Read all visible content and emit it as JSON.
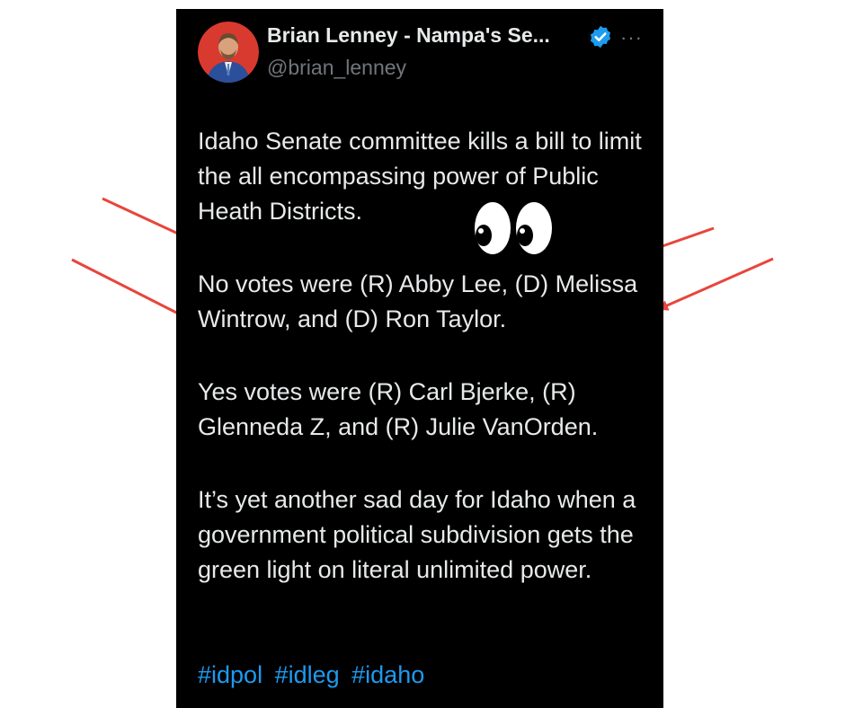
{
  "tweet": {
    "author_name": "Brian Lenney - Nampa's Se...",
    "author_handle": "@brian_lenney",
    "paragraphs": [
      "Idaho Senate committee kills a bill to limit the all encompassing power of Public Heath Districts.",
      "No votes were (R) Abby Lee, (D) Melissa Wintrow, and (D) Ron Taylor.",
      "Yes votes were (R) Carl Bjerke, (R) Glenneda Z, and (R) Julie VanOrden.",
      "It’s yet another sad day for Idaho when a government political subdivision gets the green light on literal unlimited power."
    ],
    "hashtags": [
      "#idpol",
      "#idleg",
      "#idaho"
    ]
  },
  "icons": {
    "verified": "verified-badge-icon",
    "more": "more-options-icon",
    "eyes": "eyes-emoji-icon",
    "arrows": "red-arrow-icon"
  },
  "colors": {
    "background": "#000000",
    "text": "#e7e9ea",
    "muted": "#71767b",
    "link": "#1d9bf0",
    "verified": "#1d9bf0",
    "arrow": "#e8453c",
    "avatar_bg": "#d93a2f"
  }
}
